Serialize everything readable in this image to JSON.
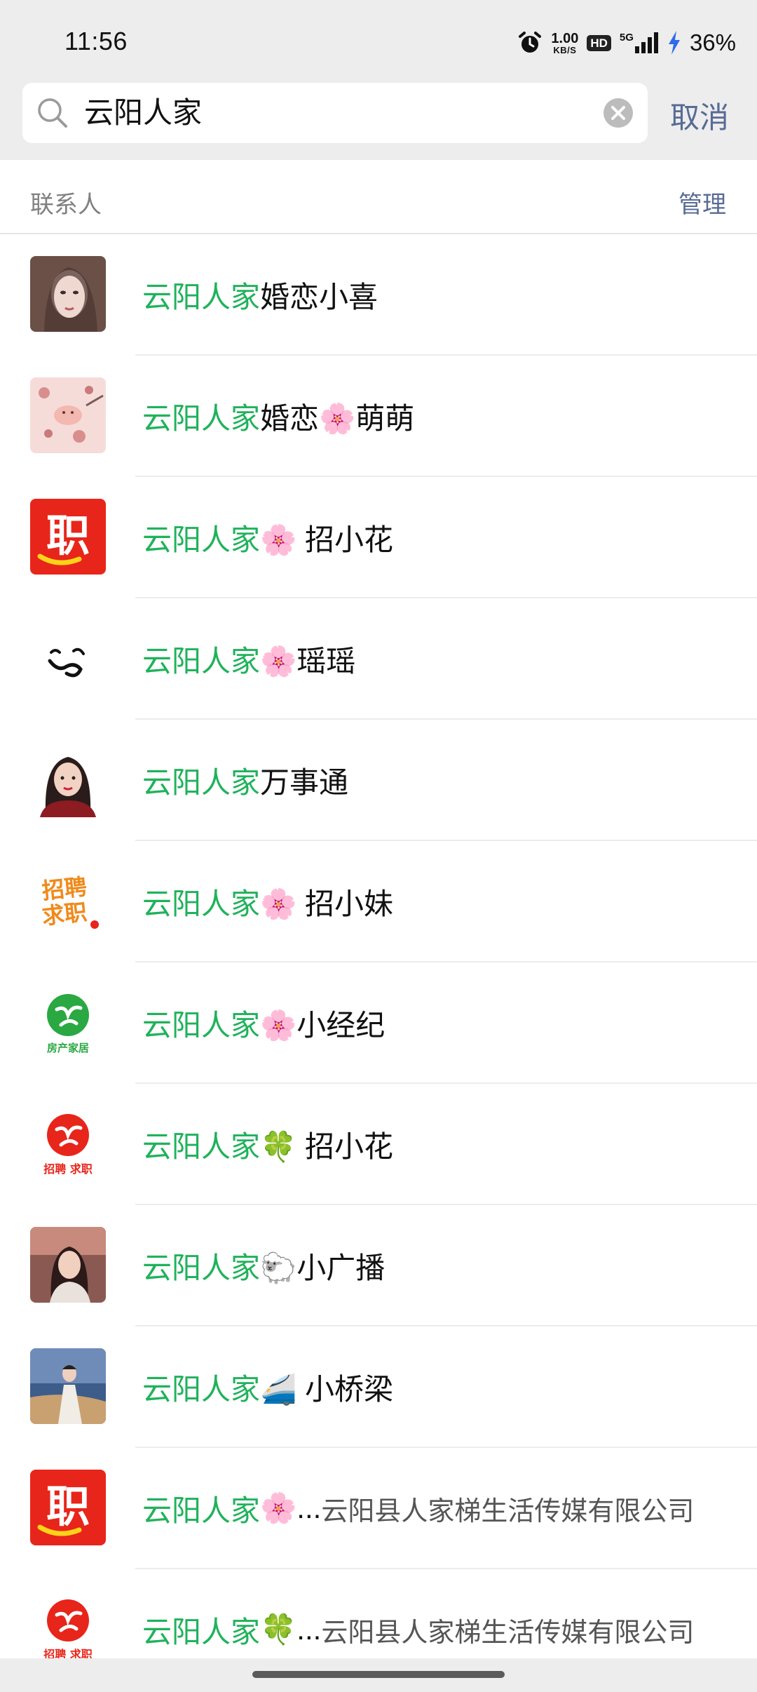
{
  "status_bar": {
    "time": "11:56",
    "net_speed_value": "1.00",
    "net_speed_unit": "KB/S",
    "hd_badge": "HD",
    "network_type": "5G",
    "battery": "36%"
  },
  "search": {
    "query": "云阳人家",
    "cancel_label": "取消"
  },
  "section": {
    "title": "联系人",
    "manage_label": "管理"
  },
  "contacts": [
    {
      "highlight": "云阳人家",
      "rest": "婚恋小喜",
      "avatar": "woman-portrait-avatar"
    },
    {
      "highlight": "云阳人家",
      "rest": "婚恋🌸萌萌",
      "avatar": "pink-illustration-avatar"
    },
    {
      "highlight": "云阳人家",
      "rest": "🌸 招小花",
      "avatar": "job-logo-avatar"
    },
    {
      "highlight": "云阳人家",
      "rest": "🌸瑶瑶",
      "avatar": "smiley-doodle-avatar"
    },
    {
      "highlight": "云阳人家",
      "rest": "万事通",
      "avatar": "cartoon-girl-avatar"
    },
    {
      "highlight": "云阳人家",
      "rest": "🌸 招小妹",
      "avatar": "recruit-text-avatar"
    },
    {
      "highlight": "云阳人家",
      "rest": "🌸小经纪",
      "avatar": "real-estate-logo-avatar"
    },
    {
      "highlight": "云阳人家",
      "rest": "🍀 招小花",
      "avatar": "recruit-red-logo-avatar"
    },
    {
      "highlight": "云阳人家",
      "rest": "🐑小广播",
      "avatar": "girl-photo-avatar"
    },
    {
      "highlight": "云阳人家",
      "rest": "🚄 小桥梁",
      "avatar": "woman-outdoor-avatar"
    },
    {
      "highlight": "云阳人家",
      "rest": "🌸...",
      "suffix": "云阳县人家梯生活传媒有限公司",
      "avatar": "job-logo-avatar"
    },
    {
      "highlight": "云阳人家",
      "rest": "🍀...",
      "suffix": "云阳县人家梯生活传媒有限公司",
      "avatar": "recruit-red-logo-avatar"
    }
  ],
  "avatar_texts": {
    "job_logo": "职",
    "recruit_line1": "招聘",
    "recruit_line2": "求职",
    "real_estate_caption": "房产家居",
    "recruit_red_caption": "招聘 求职"
  },
  "colors": {
    "highlight": "#20b25b",
    "link": "#576b95",
    "background": "#ededed"
  }
}
